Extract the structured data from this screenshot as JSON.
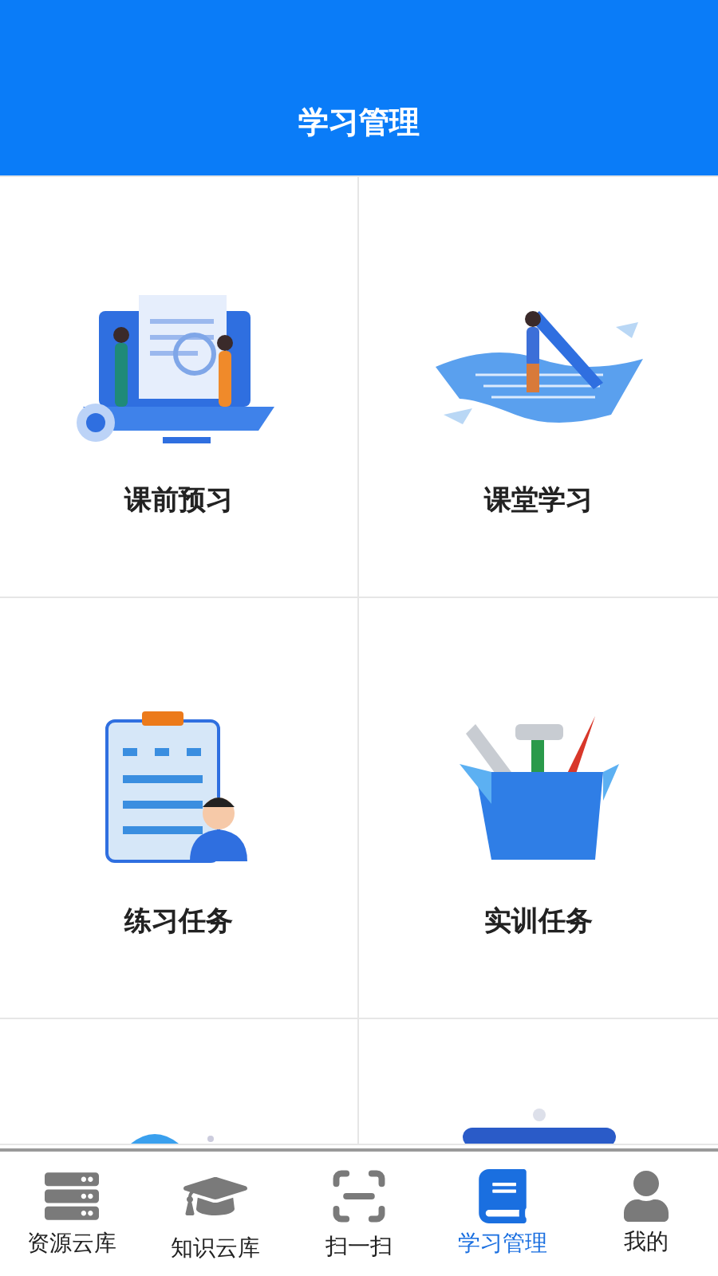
{
  "header": {
    "title": "学习管理"
  },
  "tiles": [
    {
      "kind": "full",
      "label": "课前预习"
    },
    {
      "kind": "full",
      "label": "课堂学习"
    },
    {
      "kind": "full",
      "label": "练习任务"
    },
    {
      "kind": "full",
      "label": "实训任务"
    },
    {
      "kind": "partial"
    },
    {
      "kind": "partial"
    }
  ],
  "tab_bar": [
    {
      "label": "资源云库",
      "selected": false
    },
    {
      "label": "知识云库",
      "selected": false
    },
    {
      "label": "扫一扫",
      "selected": false
    },
    {
      "label": "学习管理",
      "selected": true
    },
    {
      "label": "我的",
      "selected": false
    }
  ]
}
